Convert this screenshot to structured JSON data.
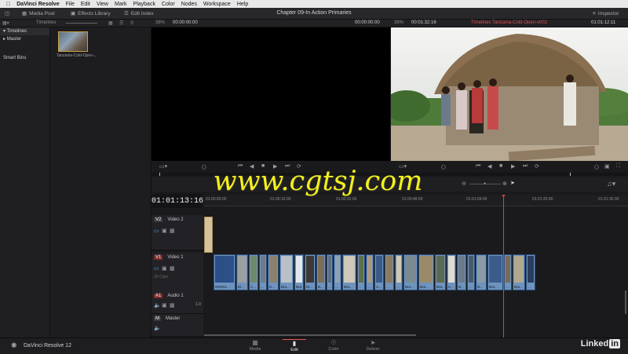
{
  "menubar": {
    "apple": "",
    "app": "DaVinci Resolve",
    "items": [
      "File",
      "Edit",
      "View",
      "Mark",
      "Playback",
      "Color",
      "Nodes",
      "Workspace",
      "Help"
    ]
  },
  "toolbar": {
    "media_pool": "Media Pool",
    "effects_library": "Effects Library",
    "edit_index": "Edit Index",
    "title": "Chapter 09-In Action Primaries",
    "inspector": "Inspector"
  },
  "subbar": {
    "timelines": "Timelines",
    "source_zoom": "38%",
    "source_tc_left": "00:00:00:00",
    "source_tc_right": "00:00:00:00",
    "timeline_zoom": "38%",
    "timeline_duration": "00:01:32:16",
    "timeline_name": "Timelines Tanzania-Cold-Open-v002",
    "timeline_tc": "01:01:12:11"
  },
  "left_panel": {
    "timelines": "Timelines",
    "master": "Master",
    "smart_bins": "Smart Bins"
  },
  "media_pool": {
    "clip_name": "Tanzania-Cold-Open-..."
  },
  "timeline": {
    "timecode": "01:01:13:16",
    "ruler": [
      "01:00:00:00",
      "01:00:16:00",
      "01:00:32:00",
      "01:00:48:00",
      "01:01:04:00",
      "01:01:20:00",
      "01:01:36:00"
    ],
    "tracks": {
      "v2": {
        "badge": "V2",
        "name": "Video 2"
      },
      "v1": {
        "badge": "V1",
        "name": "Video 1",
        "clips_label": "30 Clips"
      },
      "a1": {
        "badge": "A1",
        "name": "Audio 1",
        "level": "1.0"
      },
      "m": {
        "badge": "M",
        "name": "Master"
      }
    },
    "clip_labels": [
      "000001...",
      "Di...",
      "C...",
      "...",
      "D...",
      "Bra...",
      "Bra...",
      "Di...",
      "B...",
      "...",
      "...",
      "Bra...",
      "...",
      "...",
      "A...",
      "...",
      "...",
      "Bra...",
      "Bra...",
      "Bra...",
      "C...",
      "B...",
      "...",
      "B...",
      "Bra...",
      "...",
      "Bra...",
      "..."
    ]
  },
  "pages": [
    "Media",
    "Edit",
    "Color",
    "Deliver"
  ],
  "bottom": {
    "brand": "DaVinci Resolve 12",
    "linkedin_text": "Linked",
    "linkedin_in": "in"
  },
  "watermark": "www.cgtsj.com"
}
